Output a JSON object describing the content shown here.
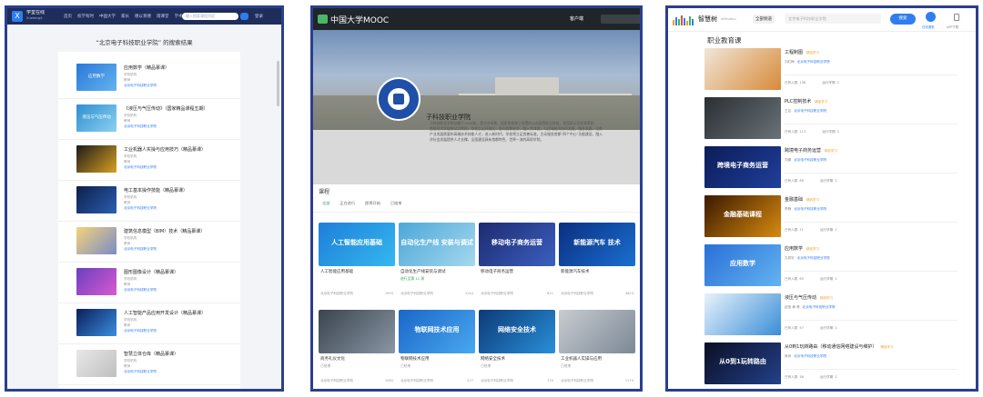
{
  "panel1": {
    "brand_line1": "学堂在线",
    "brand_line2": "XuetangX",
    "nav": [
      "首页",
      "校学有时",
      "中国大学",
      "家长",
      "德以育德",
      "雨课堂",
      "学术中心",
      "职业",
      "职业教育"
    ],
    "search_placeholder": "输入搜索课程内容",
    "login": "登录",
    "page_title": "“北京电子科技职业学院” 的搜索结果",
    "courses": [
      {
        "title": "应用数学（精品慕课）",
        "school": "北京电子科技职业学院",
        "thumb_text": "应用数学"
      },
      {
        "title": "《液压与气压传动》（国家精品课程五期）",
        "school": "北京电子科技职业学院",
        "thumb_text": "液压与气压传动"
      },
      {
        "title": "工业机器人实操与应用技巧（精品慕课）",
        "school": "北京电子科技职业学院",
        "thumb_text": ""
      },
      {
        "title": "电工基本操作技能（精品慕课）",
        "school": "北京电子科技职业学院",
        "thumb_text": ""
      },
      {
        "title": "建筑信息模型（BIM）技术（精品慕课）",
        "school": "北京电子科技职业学院",
        "thumb_text": ""
      },
      {
        "title": "图形图像设计（精品慕课）",
        "school": "北京电子科技职业学院",
        "thumb_text": ""
      },
      {
        "title": "人工智能产品应用开发设计（精品慕课）",
        "school": "北京电子科技职业学院",
        "thumb_text": ""
      },
      {
        "title": "智慧立体仓库（精品慕课）",
        "school": "北京电子科技职业学院",
        "thumb_text": ""
      }
    ],
    "meta_label_school": "学校机构",
    "meta_label_teacher": "教师",
    "meta_label_source": "课程来源"
  },
  "panel2": {
    "brand": "中国大学MOOC",
    "app_label": "客户端",
    "school_name": "北京电子科技职业学院",
    "school_name_visible": "子科技职业学院",
    "desc_lines": [
      "子科技职业学院创建于1958年，是北京市属、国家首批独立设置的公办高等职业院校，是国家示范性高等职",
      "首批现代学徒制试点院校，学校立足开放区，面向首都经济，融入京津冀，与区域经济协同发展，融合发展，培养",
      "产业发展需要的高端技术技能人才，进入新时代，学校将立足首善标准，主动服务首都“四个中心”功能建设，融入",
      "济社会发展提供人才支撑，全面建设具有首都特色、世界一流的高职学院。"
    ],
    "section_title": "课程",
    "tabs": [
      "全部",
      "正在进行",
      "即将开始",
      "已结束"
    ],
    "courses": [
      {
        "title": "人工智能应用基础",
        "img_text": "人工智能应用基础",
        "status": "",
        "school": "北京电子科技职业学院",
        "count": "1993"
      },
      {
        "title": "自动化生产线安装与调试",
        "img_text": "自动化生产线 安装与调试",
        "status": "进行至第 11 周",
        "school": "北京电子科技职业学院",
        "count": "1244"
      },
      {
        "title": "移动电子商务运营",
        "img_text": "移动电子商务运营",
        "status": "",
        "school": "北京电子科技职业学院",
        "count": "811"
      },
      {
        "title": "新能源汽车技术",
        "img_text": "新能源汽车 技术",
        "status": "",
        "school": "北京电子科技职业学院",
        "count": "4823"
      },
      {
        "title": "商务礼仪文化",
        "img_text": "",
        "status": "已结束",
        "school": "北京电子科技职业学院",
        "count": "1065"
      },
      {
        "title": "物联网技术应用",
        "img_text": "物联网技术应用",
        "status": "已结束",
        "school": "北京电子科技职业学院",
        "count": "227"
      },
      {
        "title": "网络安全技术",
        "img_text": "网络安全技术",
        "status": "已结束",
        "school": "北京电子科技职业学院",
        "count": "720"
      },
      {
        "title": "工业机器人实操与应用",
        "img_text": "",
        "status": "已结束",
        "school": "北京电子科技职业学院",
        "count": "1179"
      }
    ]
  },
  "panel3": {
    "brand": "智慧树",
    "brand_sub": "zhihuishu",
    "search_type": "全部频道",
    "search_placeholder": "北京电子科技职业学院",
    "search_button": "搜索",
    "icon1_label": "在线课堂",
    "icon2_label": "APP下载",
    "section_title": "职业教育课",
    "badge": "精品学习",
    "learners_label": "已有人数",
    "runs_label": "运行学期",
    "courses": [
      {
        "title": "工程制图",
        "teacher": "刘红梅",
        "school": "北京电子科技职业学院",
        "learners": "136",
        "runs": "2",
        "thumb_text": ""
      },
      {
        "title": "PLC控制技术",
        "teacher": "王芸",
        "school": "北京电子科技职业学院",
        "learners": "113",
        "runs": "2",
        "thumb_text": ""
      },
      {
        "title": "跨境电子商务运营",
        "teacher": "刘娜",
        "school": "北京电子科技职业学院",
        "learners": "86",
        "runs": "2",
        "thumb_text": "跨境电子商务运营"
      },
      {
        "title": "金融基础",
        "teacher": "李静",
        "school": "北京电子科技职业学院",
        "learners": "71",
        "runs": "2",
        "thumb_text": "金融基础课程"
      },
      {
        "title": "应用数学",
        "teacher": "孔祥宇",
        "school": "北京电子科技职业学院",
        "learners": "69",
        "runs": "2",
        "thumb_text": "应用数学"
      },
      {
        "title": "液压与气压传动",
        "teacher": "赵莹 黄 等",
        "school": "北京电子科技职业学院",
        "learners": "57",
        "runs": "2",
        "thumb_text": ""
      },
      {
        "title": "从0到1玩转路由（移动通信网络建设与维护）",
        "teacher": "吴琼",
        "school": "北京电子科技职业学院",
        "learners": "38",
        "runs": "2",
        "thumb_text": "从0到1玩转路由"
      }
    ]
  },
  "colors": {
    "frame": "#2a3f8f",
    "xuetang_nav": "#1e2d5a",
    "mooc_green": "#2e9d58",
    "zhs_blue": "#2f7ef0",
    "badge_orange": "#f0a020"
  }
}
